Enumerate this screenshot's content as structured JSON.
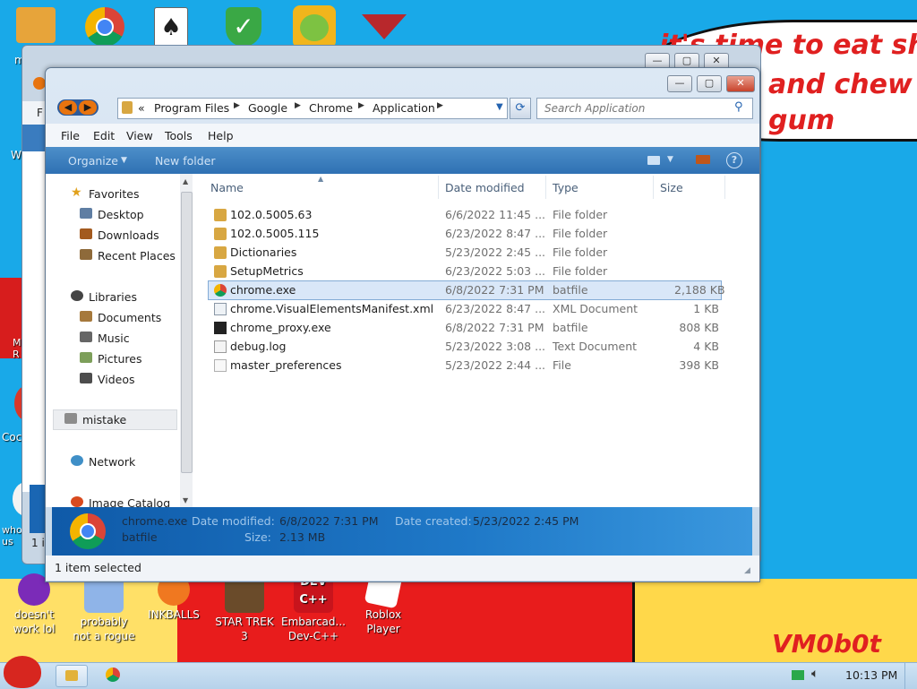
{
  "wallpaper": {
    "bubble_line1": "it's time to eat shit",
    "bubble_line2": "and chew",
    "bubble_line3": "gum",
    "signature": "VM0b0t"
  },
  "desktop_icons_bottom": [
    {
      "label": "doesn't work lol"
    },
    {
      "label": "probably not a rogue"
    },
    {
      "label": "INKBALLS"
    },
    {
      "label": "STAR TREK 3"
    },
    {
      "label": "Embarcad... Dev-C++"
    },
    {
      "label": "Roblox Player"
    }
  ],
  "desktop_icons_left_partial": [
    "m",
    "W",
    "M R",
    "Coc",
    "who us"
  ],
  "back_window": {
    "status_partial": "1 it",
    "menu_partial": "F"
  },
  "explorer": {
    "breadcrumbs": [
      "«",
      "Program Files",
      "Google",
      "Chrome",
      "Application"
    ],
    "search_placeholder": "Search Application",
    "menu": [
      "File",
      "Edit",
      "View",
      "Tools",
      "Help"
    ],
    "commands": {
      "organize": "Organize",
      "new_folder": "New folder"
    },
    "nav": {
      "favorites": "Favorites",
      "desktop": "Desktop",
      "downloads": "Downloads",
      "recent_places": "Recent Places",
      "libraries": "Libraries",
      "documents": "Documents",
      "music": "Music",
      "pictures": "Pictures",
      "videos": "Videos",
      "mistake": "mistake",
      "network": "Network",
      "image_catalog": "Image Catalog"
    },
    "columns": {
      "name": "Name",
      "date": "Date modified",
      "type": "Type",
      "size": "Size"
    },
    "files": [
      {
        "name": "102.0.5005.63",
        "date": "6/6/2022 11:45 ...",
        "type": "File folder",
        "size": "",
        "icon": "folder-icon"
      },
      {
        "name": "102.0.5005.115",
        "date": "6/23/2022 8:47 ...",
        "type": "File folder",
        "size": "",
        "icon": "folder-icon"
      },
      {
        "name": "Dictionaries",
        "date": "5/23/2022 2:45 ...",
        "type": "File folder",
        "size": "",
        "icon": "folder-icon"
      },
      {
        "name": "SetupMetrics",
        "date": "6/23/2022 5:03 ...",
        "type": "File folder",
        "size": "",
        "icon": "folder-icon"
      },
      {
        "name": "chrome.exe",
        "date": "6/8/2022 7:31 PM",
        "type": "batfile",
        "size": "2,188 KB",
        "icon": "chrome-icon"
      },
      {
        "name": "chrome.VisualElementsManifest.xml",
        "date": "6/23/2022 8:47 ...",
        "type": "XML Document",
        "size": "1 KB",
        "icon": "xml-file-icon"
      },
      {
        "name": "chrome_proxy.exe",
        "date": "6/8/2022 7:31 PM",
        "type": "batfile",
        "size": "808 KB",
        "icon": "exe-file-icon"
      },
      {
        "name": "debug.log",
        "date": "5/23/2022 3:08 ...",
        "type": "Text Document",
        "size": "4 KB",
        "icon": "text-file-icon"
      },
      {
        "name": "master_preferences",
        "date": "5/23/2022 2:44 ...",
        "type": "File",
        "size": "398 KB",
        "icon": "generic-file-icon"
      }
    ],
    "details": {
      "name": "chrome.exe",
      "type": "batfile",
      "date_modified_label": "Date modified:",
      "date_modified": "6/8/2022 7:31 PM",
      "date_created_label": "Date created:",
      "date_created": "5/23/2022 2:45 PM",
      "size_label": "Size:",
      "size": "2.13 MB"
    },
    "status": "1 item selected"
  },
  "taskbar": {
    "clock": "10:13 PM"
  },
  "colors": {
    "accent": "#2f71b3",
    "wallpaper_blue": "#19a9e8",
    "wallpaper_red": "#e81c1c"
  }
}
